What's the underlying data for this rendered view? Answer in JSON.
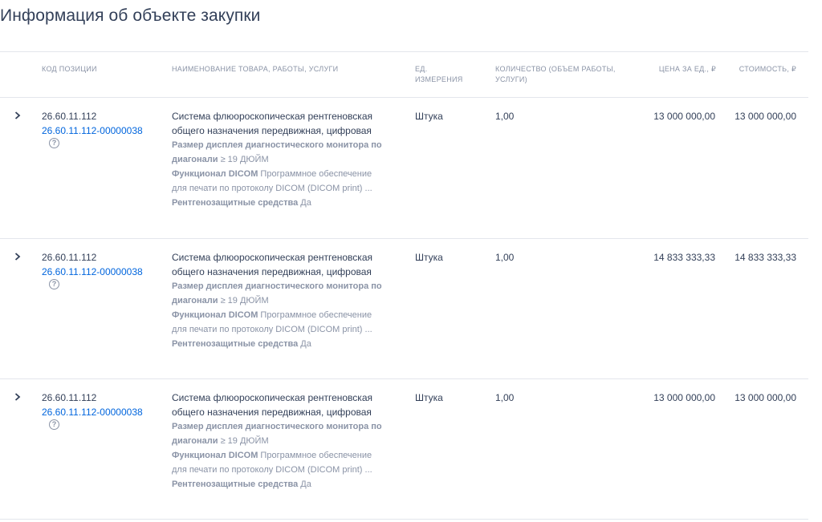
{
  "page": {
    "title": "Информация об объекте закупки"
  },
  "table": {
    "headers": {
      "code": "КОД ПОЗИЦИИ",
      "name": "НАИМЕНОВАНИЕ ТОВАРА, РАБОТЫ, УСЛУГИ",
      "unit_1": "ЕД.",
      "unit_2": "ИЗМЕРЕНИЯ",
      "qty_1": "КОЛИЧЕСТВО (ОБЪЕМ РАБОТЫ,",
      "qty_2": "УСЛУГИ)",
      "price": "ЦЕНА ЗА ЕД., ₽",
      "cost": "СТОИМОСТЬ, ₽"
    },
    "rows": [
      {
        "okpd": "26.60.11.112",
        "ktru": "26.60.11.112-00000038",
        "help_glyph": "?",
        "name_1": "Система флюороскопическая рентгеновская",
        "name_2": "общего назначения передвижная, цифровая",
        "attr1_label_1": "Размер дисплея диагностического монитора по",
        "attr1_label_2": "диагонали",
        "attr1_value": " ≥ 19 ДЮЙМ",
        "attr2_label": "Функционал DICOM",
        "attr2_value_1": " Программное обеспечение",
        "attr2_value_2": "для печати по протоколу DICOM (DICOM print) ...",
        "attr3_label": "Рентгенозащитные средства",
        "attr3_value": " Да",
        "unit": "Штука",
        "qty": "1,00",
        "price": "13 000 000,00",
        "cost": "13 000 000,00"
      },
      {
        "okpd": "26.60.11.112",
        "ktru": "26.60.11.112-00000038",
        "help_glyph": "?",
        "name_1": "Система флюороскопическая рентгеновская",
        "name_2": "общего назначения передвижная, цифровая",
        "attr1_label_1": "Размер дисплея диагностического монитора по",
        "attr1_label_2": "диагонали",
        "attr1_value": " ≥ 19 ДЮЙМ",
        "attr2_label": "Функционал DICOM",
        "attr2_value_1": " Программное обеспечение",
        "attr2_value_2": "для печати по протоколу DICOM (DICOM print) ...",
        "attr3_label": "Рентгенозащитные средства",
        "attr3_value": " Да",
        "unit": "Штука",
        "qty": "1,00",
        "price": "14 833 333,33",
        "cost": "14 833 333,33"
      },
      {
        "okpd": "26.60.11.112",
        "ktru": "26.60.11.112-00000038",
        "help_glyph": "?",
        "name_1": "Система флюороскопическая рентгеновская",
        "name_2": "общего назначения передвижная, цифровая",
        "attr1_label_1": "Размер дисплея диагностического монитора по",
        "attr1_label_2": "диагонали",
        "attr1_value": " ≥ 19 ДЮЙМ",
        "attr2_label": "Функционал DICOM",
        "attr2_value_1": " Программное обеспечение",
        "attr2_value_2": "для печати по протоколу DICOM (DICOM print) ...",
        "attr3_label": "Рентгенозащитные средства",
        "attr3_value": " Да",
        "unit": "Штука",
        "qty": "1,00",
        "price": "13 000 000,00",
        "cost": "13 000 000,00"
      }
    ]
  },
  "icons": {
    "expand": "chevron-right-icon",
    "help": "question-circle-icon"
  },
  "colors": {
    "link": "#0065dd",
    "text": "#334059",
    "muted": "#8a93a6",
    "divider": "#e3e6ec"
  }
}
